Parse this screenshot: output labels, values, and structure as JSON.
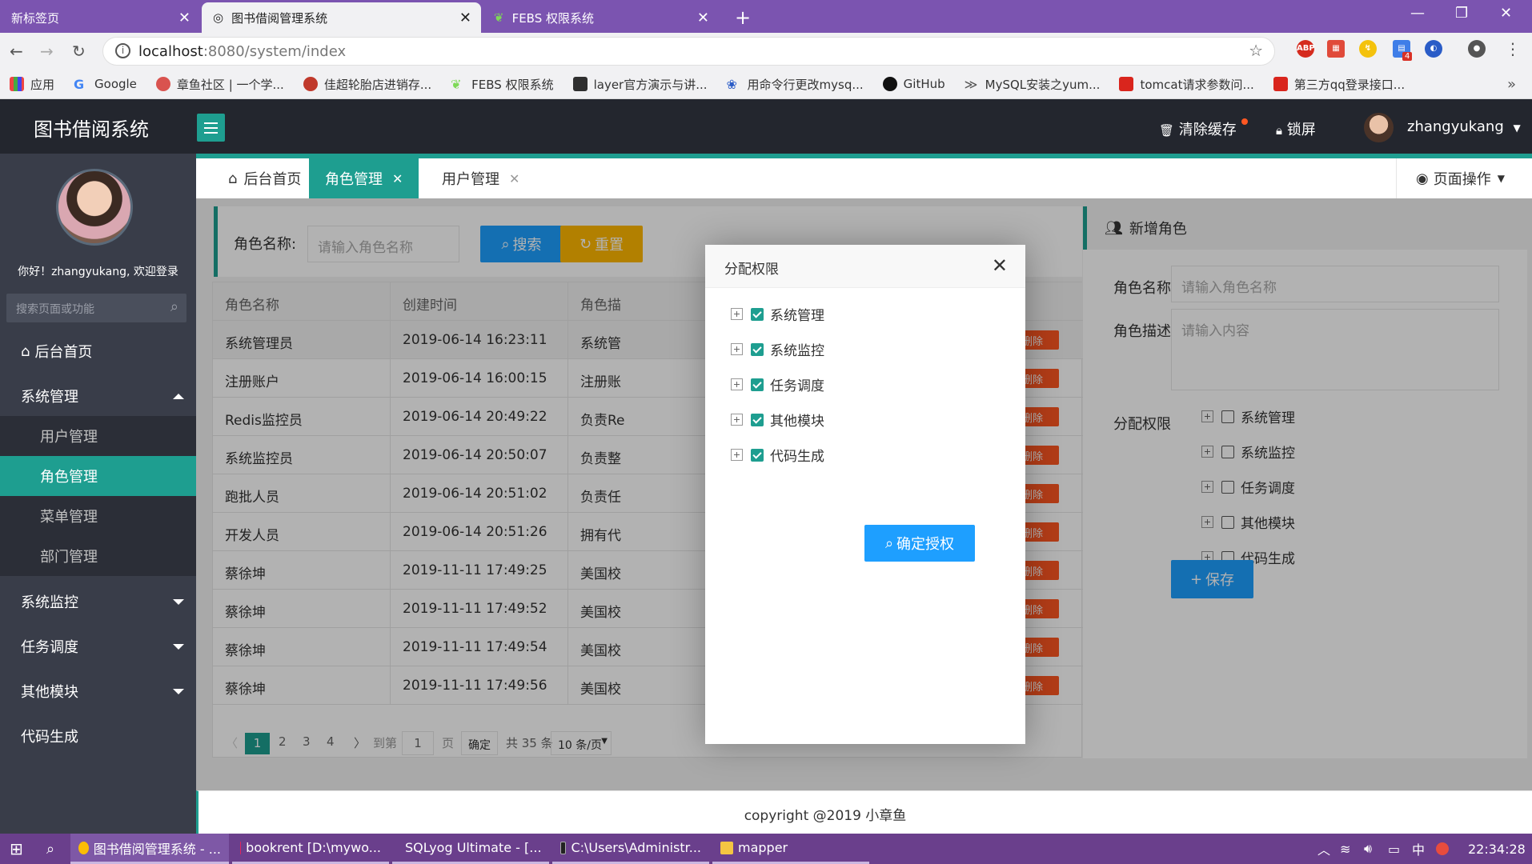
{
  "browser": {
    "tabs": [
      {
        "title": "新标签页"
      },
      {
        "title": "图书借阅管理系统"
      },
      {
        "title": "FEBS 权限系统"
      }
    ],
    "url_host": "localhost",
    "url_rest": ":8080/system/index",
    "bookmarks": [
      "应用",
      "Google",
      "章鱼社区 | 一个学...",
      "佳超轮胎店进销存...",
      "FEBS 权限系统",
      "layer官方演示与讲...",
      "用命令行更改mysq...",
      "GitHub",
      "MySQL安装之yum...",
      "tomcat请求参数问...",
      "第三方qq登录接口..."
    ],
    "more": "»",
    "ext_badge": "4"
  },
  "app": {
    "logo": "图书借阅系统",
    "clear_cache": "清除缓存",
    "lock": "锁屏",
    "username": "zhangyukang",
    "welcome": "你好！zhangyukang, 欢迎登录",
    "search_placeholder": "搜索页面或功能"
  },
  "sidebar": {
    "home": "后台首页",
    "sys_mgmt": "系统管理",
    "subs": [
      "用户管理",
      "角色管理",
      "菜单管理",
      "部门管理"
    ],
    "sys_monitor": "系统监控",
    "task": "任务调度",
    "other": "其他模块",
    "codegen": "代码生成"
  },
  "tabs": {
    "home": "后台首页",
    "role": "角色管理",
    "user": "用户管理",
    "page_op": "页面操作"
  },
  "search": {
    "label": "角色名称:",
    "placeholder": "请输入角色名称",
    "search_btn": "搜索",
    "reset_btn": "重置"
  },
  "table": {
    "headers": [
      "角色名称",
      "创建时间",
      "角色描"
    ],
    "delete_label": "删除",
    "rows": [
      [
        "系统管理员",
        "2019-06-14 16:23:11",
        "系统管"
      ],
      [
        "注册账户",
        "2019-06-14 16:00:15",
        "注册账"
      ],
      [
        "Redis监控员",
        "2019-06-14 20:49:22",
        "负责Re"
      ],
      [
        "系统监控员",
        "2019-06-14 20:50:07",
        "负责整"
      ],
      [
        "跑批人员",
        "2019-06-14 20:51:02",
        "负责任"
      ],
      [
        "开发人员",
        "2019-06-14 20:51:26",
        "拥有代"
      ],
      [
        "蔡徐坤",
        "2019-11-11 17:49:25",
        "美国校"
      ],
      [
        "蔡徐坤",
        "2019-11-11 17:49:52",
        "美国校"
      ],
      [
        "蔡徐坤",
        "2019-11-11 17:49:54",
        "美国校"
      ],
      [
        "蔡徐坤",
        "2019-11-11 17:49:56",
        "美国校"
      ]
    ]
  },
  "pager": {
    "pages": [
      "1",
      "2",
      "3",
      "4"
    ],
    "goto": "到第",
    "goto_value": "1",
    "page_unit": "页",
    "confirm": "确定",
    "total": "共 35 条",
    "per_page": "10 条/页"
  },
  "right_panel": {
    "title": "新增角色",
    "name_label": "角色名称",
    "name_placeholder": "请输入角色名称",
    "desc_label": "角色描述",
    "desc_placeholder": "请输入内容",
    "perm_label": "分配权限",
    "perms": [
      "系统管理",
      "系统监控",
      "任务调度",
      "其他模块",
      "代码生成"
    ],
    "save": "保存"
  },
  "modal": {
    "title": "分配权限",
    "perms": [
      "系统管理",
      "系统监控",
      "任务调度",
      "其他模块",
      "代码生成"
    ],
    "confirm": "确定授权"
  },
  "footer": "copyright @2019 小章鱼",
  "taskbar": {
    "items": [
      "图书借阅管理系统 - ...",
      "bookrent [D:\\mywo...",
      "SQLyog Ultimate - [...",
      "C:\\Users\\Administr...",
      "mapper"
    ],
    "ime": "中",
    "time": "22:34:28"
  },
  "colors": {
    "accent": "#1e9e90",
    "danger": "#ff5722",
    "primary": "#1e9fff",
    "warn": "#ffb800"
  }
}
